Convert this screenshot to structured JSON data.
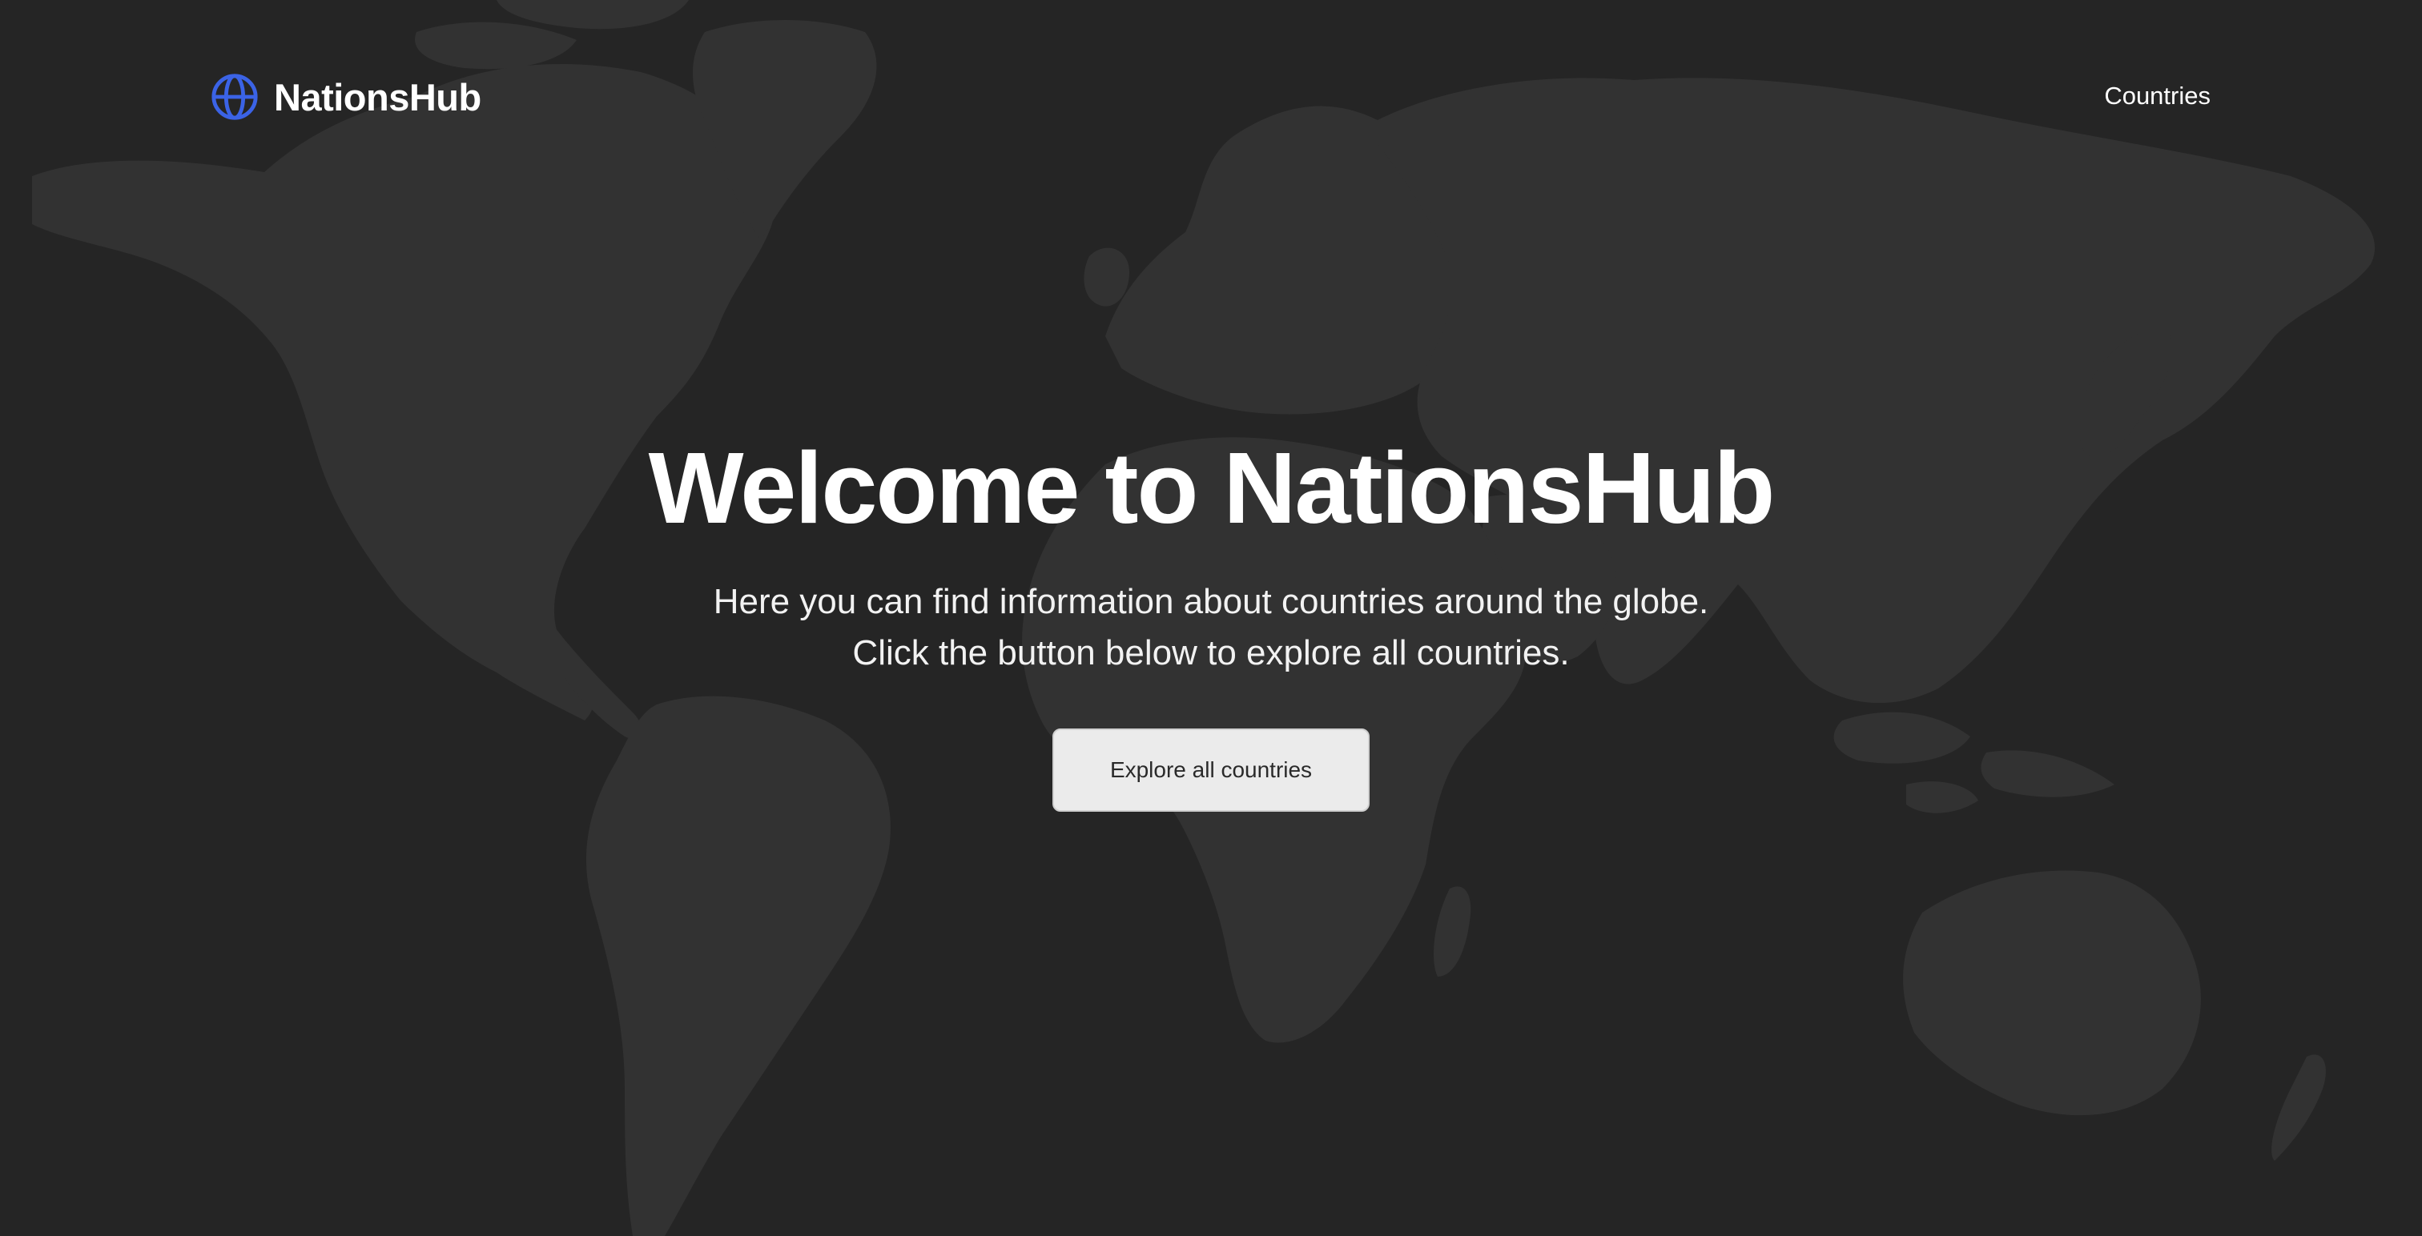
{
  "header": {
    "brand_name": "NationsHub",
    "brand_icon": "globe-icon",
    "nav_countries_label": "Countries"
  },
  "hero": {
    "title": "Welcome to NationsHub",
    "subtitle_line1": "Here you can find information about countries around the globe.",
    "subtitle_line2": "Click the button below to explore all countries.",
    "cta_label": "Explore all countries"
  },
  "theme": {
    "background": "#252525",
    "map_land": "#323232",
    "accent": "#3b63e6",
    "button_bg": "#ebebeb",
    "text": "#ffffff"
  }
}
